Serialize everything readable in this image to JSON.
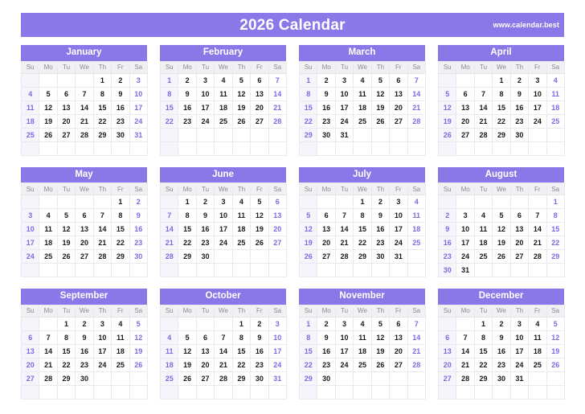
{
  "header": {
    "title": "2026 Calendar",
    "website": "www.calendar.best",
    "accent_color": "#8878e8",
    "weekend_color": "#7b6be3",
    "weekday_header_bg": "#f1f1f3",
    "sunday_column_bg": "#f6f5fb"
  },
  "weekday_labels": [
    "Su",
    "Mo",
    "Tu",
    "We",
    "Th",
    "Fr",
    "Sa"
  ],
  "year": "2026",
  "months": [
    {
      "name": "January",
      "weeks": [
        [
          "",
          "",
          "",
          "",
          "1",
          "2",
          "3"
        ],
        [
          "4",
          "5",
          "6",
          "7",
          "8",
          "9",
          "10"
        ],
        [
          "11",
          "12",
          "13",
          "14",
          "15",
          "16",
          "17"
        ],
        [
          "18",
          "19",
          "20",
          "21",
          "22",
          "23",
          "24"
        ],
        [
          "25",
          "26",
          "27",
          "28",
          "29",
          "30",
          "31"
        ],
        [
          "",
          "",
          "",
          "",
          "",
          "",
          ""
        ]
      ]
    },
    {
      "name": "February",
      "weeks": [
        [
          "1",
          "2",
          "3",
          "4",
          "5",
          "6",
          "7"
        ],
        [
          "8",
          "9",
          "10",
          "11",
          "12",
          "13",
          "14"
        ],
        [
          "15",
          "16",
          "17",
          "18",
          "19",
          "20",
          "21"
        ],
        [
          "22",
          "23",
          "24",
          "25",
          "26",
          "27",
          "28"
        ],
        [
          "",
          "",
          "",
          "",
          "",
          "",
          ""
        ],
        [
          "",
          "",
          "",
          "",
          "",
          "",
          ""
        ]
      ]
    },
    {
      "name": "March",
      "weeks": [
        [
          "1",
          "2",
          "3",
          "4",
          "5",
          "6",
          "7"
        ],
        [
          "8",
          "9",
          "10",
          "11",
          "12",
          "13",
          "14"
        ],
        [
          "15",
          "16",
          "17",
          "18",
          "19",
          "20",
          "21"
        ],
        [
          "22",
          "23",
          "24",
          "25",
          "26",
          "27",
          "28"
        ],
        [
          "29",
          "30",
          "31",
          "",
          "",
          "",
          ""
        ],
        [
          "",
          "",
          "",
          "",
          "",
          "",
          ""
        ]
      ]
    },
    {
      "name": "April",
      "weeks": [
        [
          "",
          "",
          "",
          "1",
          "2",
          "3",
          "4"
        ],
        [
          "5",
          "6",
          "7",
          "8",
          "9",
          "10",
          "11"
        ],
        [
          "12",
          "13",
          "14",
          "15",
          "16",
          "17",
          "18"
        ],
        [
          "19",
          "20",
          "21",
          "22",
          "23",
          "24",
          "25"
        ],
        [
          "26",
          "27",
          "28",
          "29",
          "30",
          "",
          ""
        ],
        [
          "",
          "",
          "",
          "",
          "",
          "",
          ""
        ]
      ]
    },
    {
      "name": "May",
      "weeks": [
        [
          "",
          "",
          "",
          "",
          "",
          "1",
          "2"
        ],
        [
          "3",
          "4",
          "5",
          "6",
          "7",
          "8",
          "9"
        ],
        [
          "10",
          "11",
          "12",
          "13",
          "14",
          "15",
          "16"
        ],
        [
          "17",
          "18",
          "19",
          "20",
          "21",
          "22",
          "23"
        ],
        [
          "24",
          "25",
          "26",
          "27",
          "28",
          "29",
          "30"
        ],
        [
          "",
          "",
          "",
          "",
          "",
          "",
          ""
        ]
      ]
    },
    {
      "name": "June",
      "weeks": [
        [
          "",
          "1",
          "2",
          "3",
          "4",
          "5",
          "6"
        ],
        [
          "7",
          "8",
          "9",
          "10",
          "11",
          "12",
          "13"
        ],
        [
          "14",
          "15",
          "16",
          "17",
          "18",
          "19",
          "20"
        ],
        [
          "21",
          "22",
          "23",
          "24",
          "25",
          "26",
          "27"
        ],
        [
          "28",
          "29",
          "30",
          "",
          "",
          "",
          ""
        ],
        [
          "",
          "",
          "",
          "",
          "",
          "",
          ""
        ]
      ]
    },
    {
      "name": "July",
      "weeks": [
        [
          "",
          "",
          "",
          "1",
          "2",
          "3",
          "4"
        ],
        [
          "5",
          "6",
          "7",
          "8",
          "9",
          "10",
          "11"
        ],
        [
          "12",
          "13",
          "14",
          "15",
          "16",
          "17",
          "18"
        ],
        [
          "19",
          "20",
          "21",
          "22",
          "23",
          "24",
          "25"
        ],
        [
          "26",
          "27",
          "28",
          "29",
          "30",
          "31",
          ""
        ],
        [
          "",
          "",
          "",
          "",
          "",
          "",
          ""
        ]
      ]
    },
    {
      "name": "August",
      "weeks": [
        [
          "",
          "",
          "",
          "",
          "",
          "",
          "1"
        ],
        [
          "2",
          "3",
          "4",
          "5",
          "6",
          "7",
          "8"
        ],
        [
          "9",
          "10",
          "11",
          "12",
          "13",
          "14",
          "15"
        ],
        [
          "16",
          "17",
          "18",
          "19",
          "20",
          "21",
          "22"
        ],
        [
          "23",
          "24",
          "25",
          "26",
          "27",
          "28",
          "29"
        ],
        [
          "30",
          "31",
          "",
          "",
          "",
          "",
          ""
        ]
      ]
    },
    {
      "name": "September",
      "weeks": [
        [
          "",
          "",
          "1",
          "2",
          "3",
          "4",
          "5"
        ],
        [
          "6",
          "7",
          "8",
          "9",
          "10",
          "11",
          "12"
        ],
        [
          "13",
          "14",
          "15",
          "16",
          "17",
          "18",
          "19"
        ],
        [
          "20",
          "21",
          "22",
          "23",
          "24",
          "25",
          "26"
        ],
        [
          "27",
          "28",
          "29",
          "30",
          "",
          "",
          ""
        ],
        [
          "",
          "",
          "",
          "",
          "",
          "",
          ""
        ]
      ]
    },
    {
      "name": "October",
      "weeks": [
        [
          "",
          "",
          "",
          "",
          "1",
          "2",
          "3"
        ],
        [
          "4",
          "5",
          "6",
          "7",
          "8",
          "9",
          "10"
        ],
        [
          "11",
          "12",
          "13",
          "14",
          "15",
          "16",
          "17"
        ],
        [
          "18",
          "19",
          "20",
          "21",
          "22",
          "23",
          "24"
        ],
        [
          "25",
          "26",
          "27",
          "28",
          "29",
          "30",
          "31"
        ],
        [
          "",
          "",
          "",
          "",
          "",
          "",
          ""
        ]
      ]
    },
    {
      "name": "November",
      "weeks": [
        [
          "1",
          "2",
          "3",
          "4",
          "5",
          "6",
          "7"
        ],
        [
          "8",
          "9",
          "10",
          "11",
          "12",
          "13",
          "14"
        ],
        [
          "15",
          "16",
          "17",
          "18",
          "19",
          "20",
          "21"
        ],
        [
          "22",
          "23",
          "24",
          "25",
          "26",
          "27",
          "28"
        ],
        [
          "29",
          "30",
          "",
          "",
          "",
          "",
          ""
        ],
        [
          "",
          "",
          "",
          "",
          "",
          "",
          ""
        ]
      ]
    },
    {
      "name": "December",
      "weeks": [
        [
          "",
          "",
          "1",
          "2",
          "3",
          "4",
          "5"
        ],
        [
          "6",
          "7",
          "8",
          "9",
          "10",
          "11",
          "12"
        ],
        [
          "13",
          "14",
          "15",
          "16",
          "17",
          "18",
          "19"
        ],
        [
          "20",
          "21",
          "22",
          "23",
          "24",
          "25",
          "26"
        ],
        [
          "27",
          "28",
          "29",
          "30",
          "31",
          "",
          ""
        ],
        [
          "",
          "",
          "",
          "",
          "",
          "",
          ""
        ]
      ]
    }
  ]
}
